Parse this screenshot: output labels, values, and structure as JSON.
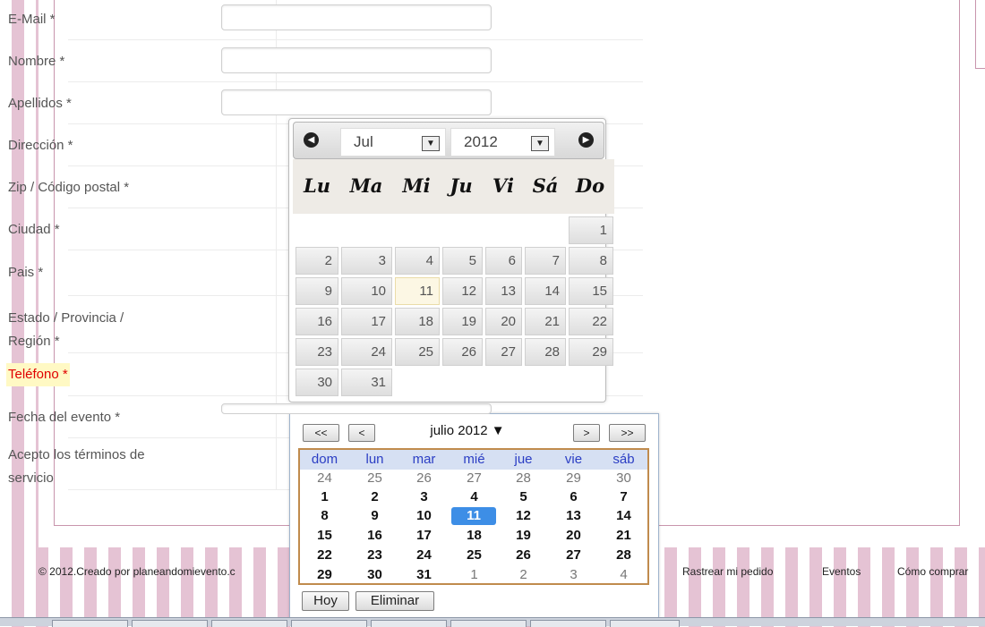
{
  "form": {
    "fields": [
      {
        "label": "E-Mail *"
      },
      {
        "label": "Nombre *"
      },
      {
        "label": "Apellidos *"
      },
      {
        "label": "Dirección *"
      },
      {
        "label": "Zip / Código postal *"
      },
      {
        "label": "Ciudad *"
      },
      {
        "label": "Pais *"
      },
      {
        "label_line1": "Estado / Provincia /",
        "label_line2": "Región *"
      },
      {
        "label": "Teléfono *"
      },
      {
        "label": "Fecha del evento *"
      },
      {
        "label_line1": "Acepto los términos de",
        "label_line2": "servicio"
      }
    ]
  },
  "datepicker": {
    "prev_icon": "prev-circle-icon",
    "next_icon": "next-circle-icon",
    "month_select": "Jul",
    "year_select": "2012",
    "weekdays": [
      "Lu",
      "Ma",
      "Mi",
      "Ju",
      "Vi",
      "Sá",
      "Do"
    ],
    "days": [
      "1",
      "2",
      "3",
      "4",
      "5",
      "6",
      "7",
      "8",
      "9",
      "10",
      "11",
      "12",
      "13",
      "14",
      "15",
      "16",
      "17",
      "18",
      "19",
      "20",
      "21",
      "22",
      "23",
      "24",
      "25",
      "26",
      "27",
      "28",
      "29",
      "30",
      "31"
    ],
    "today": "11"
  },
  "calendar2": {
    "btn_prev_year": "<<",
    "btn_prev_month": "<",
    "title": "julio 2012 ▼",
    "btn_next_month": ">",
    "btn_next_year": ">>",
    "weekdays": [
      "dom",
      "lun",
      "mar",
      "mié",
      "jue",
      "vie",
      "sáb"
    ],
    "weeks": [
      [
        "24",
        "25",
        "26",
        "27",
        "28",
        "29",
        "30"
      ],
      [
        "1",
        "2",
        "3",
        "4",
        "5",
        "6",
        "7"
      ],
      [
        "8",
        "9",
        "10",
        "11",
        "12",
        "13",
        "14"
      ],
      [
        "15",
        "16",
        "17",
        "18",
        "19",
        "20",
        "21"
      ],
      [
        "22",
        "23",
        "24",
        "25",
        "26",
        "27",
        "28"
      ],
      [
        "29",
        "30",
        "31",
        "1",
        "2",
        "3",
        "4"
      ]
    ],
    "selected": "11",
    "btn_today": "Hoy",
    "btn_clear": "Eliminar"
  },
  "footer": {
    "copyright": "© 2012.Creado por planeandomievento.c",
    "links": [
      "Rastrear mi pedido",
      "Eventos",
      "Cómo comprar"
    ]
  },
  "colors": {
    "stripe": "#e5c3d4",
    "border_pink": "#c895ad",
    "selected_blue": "#3d8ee6",
    "required_red": "#e00000"
  }
}
